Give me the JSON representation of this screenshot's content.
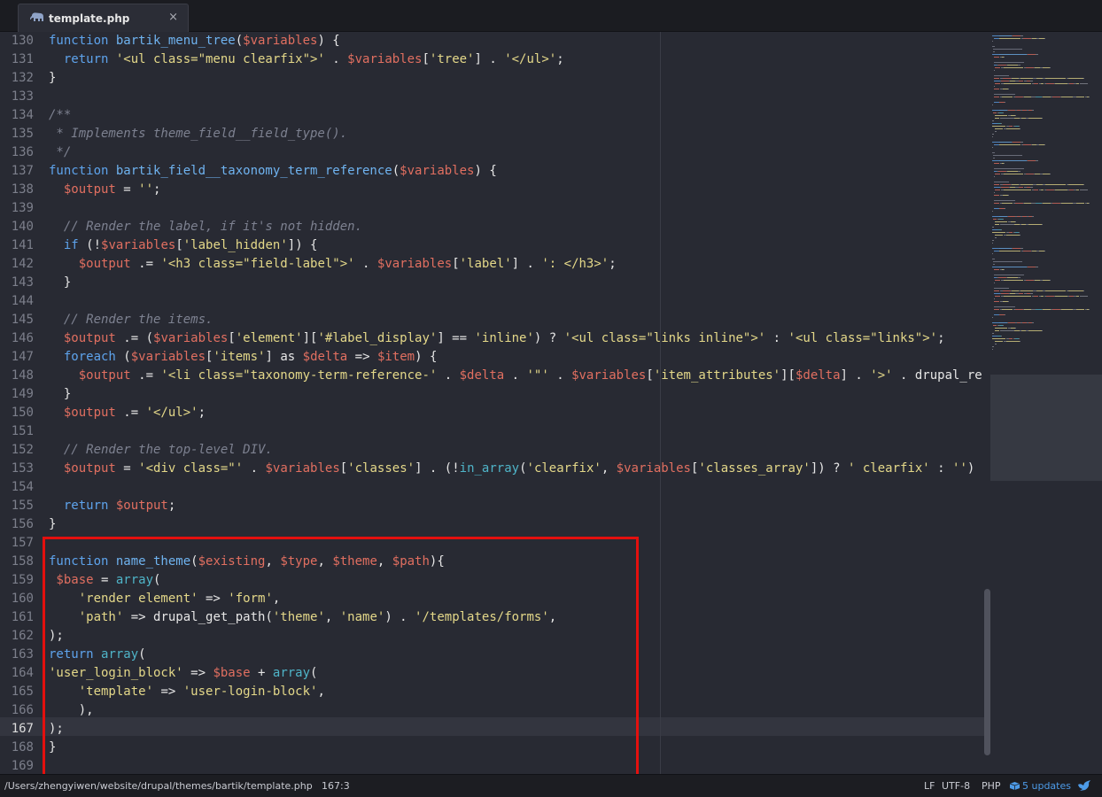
{
  "tab": {
    "title": "template.php",
    "close_glyph": "×",
    "icon": "php-elephant-icon"
  },
  "editor": {
    "active_line_number": "167",
    "lines": [
      {
        "n": "130",
        "tokens": [
          {
            "c": "kw",
            "t": "function "
          },
          {
            "c": "fn",
            "t": "bartik_menu_tree"
          },
          {
            "c": "pl",
            "t": "("
          },
          {
            "c": "var",
            "t": "$variables"
          },
          {
            "c": "pl",
            "t": ") {"
          }
        ]
      },
      {
        "n": "131",
        "tokens": [
          {
            "c": "kw",
            "t": "  return "
          },
          {
            "c": "str",
            "t": "'<ul class=\"menu clearfix\">'"
          },
          {
            "c": "pl",
            "t": " . "
          },
          {
            "c": "var",
            "t": "$variables"
          },
          {
            "c": "pl",
            "t": "["
          },
          {
            "c": "str",
            "t": "'tree'"
          },
          {
            "c": "pl",
            "t": "] . "
          },
          {
            "c": "str",
            "t": "'</ul>'"
          },
          {
            "c": "pl",
            "t": ";"
          }
        ]
      },
      {
        "n": "132",
        "tokens": [
          {
            "c": "pl",
            "t": "}"
          }
        ]
      },
      {
        "n": "133",
        "tokens": []
      },
      {
        "n": "134",
        "tokens": [
          {
            "c": "cm",
            "t": "/**"
          }
        ]
      },
      {
        "n": "135",
        "tokens": [
          {
            "c": "cm",
            "t": " * Implements theme_field__field_type()."
          }
        ]
      },
      {
        "n": "136",
        "tokens": [
          {
            "c": "cm",
            "t": " */"
          }
        ]
      },
      {
        "n": "137",
        "tokens": [
          {
            "c": "kw",
            "t": "function "
          },
          {
            "c": "fn",
            "t": "bartik_field__taxonomy_term_reference"
          },
          {
            "c": "pl",
            "t": "("
          },
          {
            "c": "var",
            "t": "$variables"
          },
          {
            "c": "pl",
            "t": ") {"
          }
        ]
      },
      {
        "n": "138",
        "tokens": [
          {
            "c": "var",
            "t": "  $output"
          },
          {
            "c": "pl",
            "t": " = "
          },
          {
            "c": "str",
            "t": "''"
          },
          {
            "c": "pl",
            "t": ";"
          }
        ]
      },
      {
        "n": "139",
        "tokens": []
      },
      {
        "n": "140",
        "tokens": [
          {
            "c": "cm",
            "t": "  // Render the label, if it's not hidden."
          }
        ]
      },
      {
        "n": "141",
        "tokens": [
          {
            "c": "kw",
            "t": "  if "
          },
          {
            "c": "pl",
            "t": "(!"
          },
          {
            "c": "var",
            "t": "$variables"
          },
          {
            "c": "pl",
            "t": "["
          },
          {
            "c": "str",
            "t": "'label_hidden'"
          },
          {
            "c": "pl",
            "t": "]) {"
          }
        ]
      },
      {
        "n": "142",
        "tokens": [
          {
            "c": "var",
            "t": "    $output"
          },
          {
            "c": "pl",
            "t": " .= "
          },
          {
            "c": "str",
            "t": "'<h3 class=\"field-label\">'"
          },
          {
            "c": "pl",
            "t": " . "
          },
          {
            "c": "var",
            "t": "$variables"
          },
          {
            "c": "pl",
            "t": "["
          },
          {
            "c": "str",
            "t": "'label'"
          },
          {
            "c": "pl",
            "t": "] . "
          },
          {
            "c": "str",
            "t": "': </h3>'"
          },
          {
            "c": "pl",
            "t": ";"
          }
        ]
      },
      {
        "n": "143",
        "tokens": [
          {
            "c": "pl",
            "t": "  }"
          }
        ]
      },
      {
        "n": "144",
        "tokens": []
      },
      {
        "n": "145",
        "tokens": [
          {
            "c": "cm",
            "t": "  // Render the items."
          }
        ]
      },
      {
        "n": "146",
        "tokens": [
          {
            "c": "var",
            "t": "  $output"
          },
          {
            "c": "pl",
            "t": " .= ("
          },
          {
            "c": "var",
            "t": "$variables"
          },
          {
            "c": "pl",
            "t": "["
          },
          {
            "c": "str",
            "t": "'element'"
          },
          {
            "c": "pl",
            "t": "]["
          },
          {
            "c": "str",
            "t": "'#label_display'"
          },
          {
            "c": "pl",
            "t": "] == "
          },
          {
            "c": "str",
            "t": "'inline'"
          },
          {
            "c": "pl",
            "t": ") ? "
          },
          {
            "c": "str",
            "t": "'<ul class=\"links inline\">'"
          },
          {
            "c": "pl",
            "t": " : "
          },
          {
            "c": "str",
            "t": "'<ul class=\"links\">'"
          },
          {
            "c": "pl",
            "t": ";"
          }
        ]
      },
      {
        "n": "147",
        "tokens": [
          {
            "c": "kw",
            "t": "  foreach "
          },
          {
            "c": "pl",
            "t": "("
          },
          {
            "c": "var",
            "t": "$variables"
          },
          {
            "c": "pl",
            "t": "["
          },
          {
            "c": "str",
            "t": "'items'"
          },
          {
            "c": "pl",
            "t": "] as "
          },
          {
            "c": "var",
            "t": "$delta"
          },
          {
            "c": "pl",
            "t": " => "
          },
          {
            "c": "var",
            "t": "$item"
          },
          {
            "c": "pl",
            "t": ") {"
          }
        ]
      },
      {
        "n": "148",
        "tokens": [
          {
            "c": "var",
            "t": "    $output"
          },
          {
            "c": "pl",
            "t": " .= "
          },
          {
            "c": "str",
            "t": "'<li class=\"taxonomy-term-reference-'"
          },
          {
            "c": "pl",
            "t": " . "
          },
          {
            "c": "var",
            "t": "$delta"
          },
          {
            "c": "pl",
            "t": " . "
          },
          {
            "c": "str",
            "t": "'\"'"
          },
          {
            "c": "pl",
            "t": " . "
          },
          {
            "c": "var",
            "t": "$variables"
          },
          {
            "c": "pl",
            "t": "["
          },
          {
            "c": "str",
            "t": "'item_attributes'"
          },
          {
            "c": "pl",
            "t": "]["
          },
          {
            "c": "var",
            "t": "$delta"
          },
          {
            "c": "pl",
            "t": "] . "
          },
          {
            "c": "str",
            "t": "'>'"
          },
          {
            "c": "pl",
            "t": " . drupal_re"
          }
        ]
      },
      {
        "n": "149",
        "tokens": [
          {
            "c": "pl",
            "t": "  }"
          }
        ]
      },
      {
        "n": "150",
        "tokens": [
          {
            "c": "var",
            "t": "  $output"
          },
          {
            "c": "pl",
            "t": " .= "
          },
          {
            "c": "str",
            "t": "'</ul>'"
          },
          {
            "c": "pl",
            "t": ";"
          }
        ]
      },
      {
        "n": "151",
        "tokens": []
      },
      {
        "n": "152",
        "tokens": [
          {
            "c": "cm",
            "t": "  // Render the top-level DIV."
          }
        ]
      },
      {
        "n": "153",
        "tokens": [
          {
            "c": "var",
            "t": "  $output"
          },
          {
            "c": "pl",
            "t": " = "
          },
          {
            "c": "str",
            "t": "'<div class=\"'"
          },
          {
            "c": "pl",
            "t": " . "
          },
          {
            "c": "var",
            "t": "$variables"
          },
          {
            "c": "pl",
            "t": "["
          },
          {
            "c": "str",
            "t": "'classes'"
          },
          {
            "c": "pl",
            "t": "] . (!"
          },
          {
            "c": "bi",
            "t": "in_array"
          },
          {
            "c": "pl",
            "t": "("
          },
          {
            "c": "str",
            "t": "'clearfix'"
          },
          {
            "c": "pl",
            "t": ", "
          },
          {
            "c": "var",
            "t": "$variables"
          },
          {
            "c": "pl",
            "t": "["
          },
          {
            "c": "str",
            "t": "'classes_array'"
          },
          {
            "c": "pl",
            "t": "]) ? "
          },
          {
            "c": "str",
            "t": "' clearfix'"
          },
          {
            "c": "pl",
            "t": " : "
          },
          {
            "c": "str",
            "t": "''"
          },
          {
            "c": "pl",
            "t": ")"
          }
        ]
      },
      {
        "n": "154",
        "tokens": []
      },
      {
        "n": "155",
        "tokens": [
          {
            "c": "kw",
            "t": "  return "
          },
          {
            "c": "var",
            "t": "$output"
          },
          {
            "c": "pl",
            "t": ";"
          }
        ]
      },
      {
        "n": "156",
        "tokens": [
          {
            "c": "pl",
            "t": "}"
          }
        ]
      },
      {
        "n": "157",
        "tokens": []
      },
      {
        "n": "158",
        "tokens": [
          {
            "c": "kw",
            "t": "function "
          },
          {
            "c": "fn",
            "t": "name_theme"
          },
          {
            "c": "pl",
            "t": "("
          },
          {
            "c": "var",
            "t": "$existing"
          },
          {
            "c": "pl",
            "t": ", "
          },
          {
            "c": "var",
            "t": "$type"
          },
          {
            "c": "pl",
            "t": ", "
          },
          {
            "c": "var",
            "t": "$theme"
          },
          {
            "c": "pl",
            "t": ", "
          },
          {
            "c": "var",
            "t": "$path"
          },
          {
            "c": "pl",
            "t": "){"
          }
        ]
      },
      {
        "n": "159",
        "tokens": [
          {
            "c": "var",
            "t": " $base"
          },
          {
            "c": "pl",
            "t": " = "
          },
          {
            "c": "bi",
            "t": "array"
          },
          {
            "c": "pl",
            "t": "("
          }
        ]
      },
      {
        "n": "160",
        "tokens": [
          {
            "c": "str",
            "t": "    'render element'"
          },
          {
            "c": "pl",
            "t": " => "
          },
          {
            "c": "str",
            "t": "'form'"
          },
          {
            "c": "pl",
            "t": ","
          }
        ]
      },
      {
        "n": "161",
        "tokens": [
          {
            "c": "str",
            "t": "    'path'"
          },
          {
            "c": "pl",
            "t": " => drupal_get_path("
          },
          {
            "c": "str",
            "t": "'theme'"
          },
          {
            "c": "pl",
            "t": ", "
          },
          {
            "c": "str",
            "t": "'name'"
          },
          {
            "c": "pl",
            "t": ") . "
          },
          {
            "c": "str",
            "t": "'/templates/forms'"
          },
          {
            "c": "pl",
            "t": ","
          }
        ]
      },
      {
        "n": "162",
        "tokens": [
          {
            "c": "pl",
            "t": ");"
          }
        ]
      },
      {
        "n": "163",
        "tokens": [
          {
            "c": "kw",
            "t": "return "
          },
          {
            "c": "bi",
            "t": "array"
          },
          {
            "c": "pl",
            "t": "("
          }
        ]
      },
      {
        "n": "164",
        "tokens": [
          {
            "c": "str",
            "t": "'user_login_block'"
          },
          {
            "c": "pl",
            "t": " => "
          },
          {
            "c": "var",
            "t": "$base"
          },
          {
            "c": "pl",
            "t": " + "
          },
          {
            "c": "bi",
            "t": "array"
          },
          {
            "c": "pl",
            "t": "("
          }
        ]
      },
      {
        "n": "165",
        "tokens": [
          {
            "c": "str",
            "t": "    'template'"
          },
          {
            "c": "pl",
            "t": " => "
          },
          {
            "c": "str",
            "t": "'user-login-block'"
          },
          {
            "c": "pl",
            "t": ","
          }
        ]
      },
      {
        "n": "166",
        "tokens": [
          {
            "c": "pl",
            "t": "    ),"
          }
        ]
      },
      {
        "n": "167",
        "tokens": [
          {
            "c": "pl",
            "t": ");"
          }
        ]
      },
      {
        "n": "168",
        "tokens": [
          {
            "c": "pl",
            "t": "}"
          }
        ]
      },
      {
        "n": "169",
        "tokens": []
      }
    ]
  },
  "colors": {
    "keyword": "#5ea3ec",
    "function": "#6fb3f0",
    "variable": "#e16f60",
    "string": "#e4d889",
    "comment": "#7d8190",
    "builtin": "#4fb4c8",
    "highlight_box": "#e3100e"
  },
  "status_bar": {
    "file_path": "/Users/zhengyiwen/website/drupal/themes/bartik/template.php",
    "cursor": "167:3",
    "line_ending": "LF",
    "encoding": "UTF-8",
    "grammar": "PHP",
    "updates": "5 updates",
    "updates_icon": "package-icon",
    "bird_icon": "bird-icon"
  }
}
